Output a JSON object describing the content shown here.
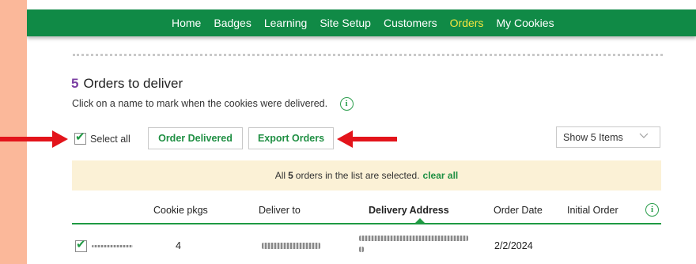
{
  "nav": {
    "items": [
      "Home",
      "Badges",
      "Learning",
      "Site Setup",
      "Customers",
      "Orders",
      "My Cookies"
    ],
    "active": "Orders"
  },
  "header": {
    "count": "5",
    "title": "Orders to deliver",
    "subtitle": "Click on a name to mark when the cookies were delivered."
  },
  "toolbar": {
    "select_all_label": "Select all",
    "order_delivered_label": "Order Delivered",
    "export_orders_label": "Export Orders",
    "show_items_label": "Show 5 Items"
  },
  "banner": {
    "prefix": "All",
    "count": "5",
    "suffix": "orders in the list are selected.",
    "clear_label": "clear all"
  },
  "table": {
    "columns": [
      "Cookie pkgs",
      "Deliver to",
      "Delivery Address",
      "Order Date",
      "Initial Order"
    ],
    "rows": [
      {
        "cookie_pkgs": "4",
        "order_date": "2/2/2024",
        "checked": true
      }
    ]
  },
  "colors": {
    "nav_bg": "#108a46",
    "nav_active": "#f5e640",
    "accent_green": "#1f8f43",
    "count_purple": "#7b3fa3",
    "banner_bg": "#fbf1d6",
    "annotation_red": "#e3141b",
    "page_bg": "#fbb89a"
  },
  "icons": {
    "info": "info-circle-icon",
    "check": "checkmark-icon",
    "chevron": "chevron-down-icon",
    "arrow": "red-arrow-icon"
  }
}
